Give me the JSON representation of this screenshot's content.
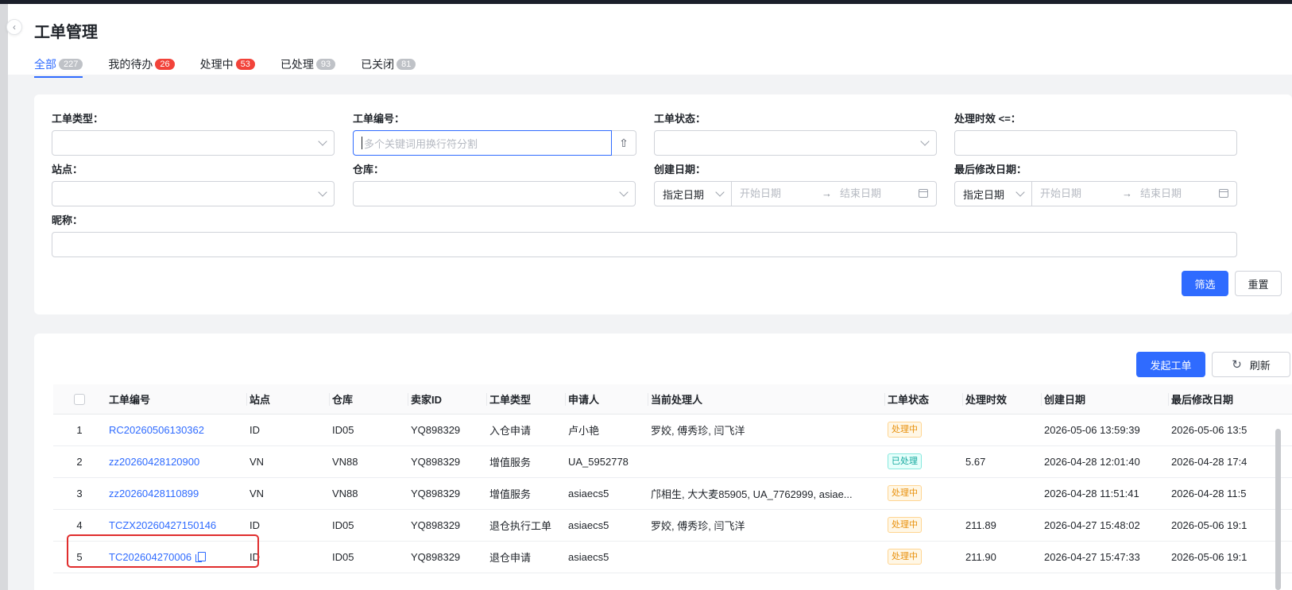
{
  "page": {
    "title": "工单管理",
    "tabs": [
      {
        "label": "全部",
        "count": "227",
        "active": true
      },
      {
        "label": "我的待办",
        "count": "26"
      },
      {
        "label": "处理中",
        "count": "53"
      },
      {
        "label": "已处理",
        "count": "93"
      },
      {
        "label": "已关闭",
        "count": "81"
      }
    ]
  },
  "filters": {
    "ticket_type": {
      "label": "工单类型："
    },
    "ticket_no": {
      "label": "工单编号：",
      "placeholder": "多个关键词用换行符分割"
    },
    "ticket_status": {
      "label": "工单状态："
    },
    "sla": {
      "label": "处理时效 <=："
    },
    "site": {
      "label": "站点："
    },
    "warehouse": {
      "label": "仓库："
    },
    "created": {
      "label": "创建日期：",
      "mode": "指定日期",
      "start": "开始日期",
      "end": "结束日期",
      "arrow": "→"
    },
    "modified": {
      "label": "最后修改日期：",
      "mode": "指定日期",
      "start": "开始日期",
      "end": "结束日期",
      "arrow": "→"
    },
    "nickname": {
      "label": "昵称："
    },
    "filter_btn": "筛选",
    "reset_btn": "重置"
  },
  "toolbar": {
    "create_btn": "发起工单",
    "refresh_btn": "刷新"
  },
  "table": {
    "columns": [
      "工单编号",
      "站点",
      "仓库",
      "卖家ID",
      "工单类型",
      "申请人",
      "当前处理人",
      "工单状态",
      "处理时效",
      "创建日期",
      "最后修改日期"
    ],
    "rows": [
      {
        "idx": "1",
        "no": "RC20260506130362",
        "site": "ID",
        "wh": "ID05",
        "seller": "YQ898329",
        "type": "入仓申请",
        "applicant": "卢小艳",
        "handler": "罗姣, 傅秀珍, 闫飞洋",
        "status": "处理中",
        "status_kind": "processing",
        "sla": "",
        "created": "2026-05-06 13:59:39",
        "modified": "2026-05-06 13:5"
      },
      {
        "idx": "2",
        "no": "zz20260428120900",
        "site": "VN",
        "wh": "VN88",
        "seller": "YQ898329",
        "type": "增值服务",
        "applicant": "UA_5952778",
        "handler": "",
        "status": "已处理",
        "status_kind": "done",
        "sla": "5.67",
        "created": "2026-04-28 12:01:40",
        "modified": "2026-04-28 17:4"
      },
      {
        "idx": "3",
        "no": "zz20260428110899",
        "site": "VN",
        "wh": "VN88",
        "seller": "YQ898329",
        "type": "增值服务",
        "applicant": "asiaecs5",
        "handler": "邝相生, 大大麦85905, UA_7762999, asiae...",
        "status": "处理中",
        "status_kind": "processing",
        "sla": "",
        "created": "2026-04-28 11:51:41",
        "modified": "2026-04-28 11:5"
      },
      {
        "idx": "4",
        "no": "TCZX20260427150146",
        "site": "ID",
        "wh": "ID05",
        "seller": "YQ898329",
        "type": "退仓执行工单",
        "applicant": "asiaecs5",
        "handler": "罗姣, 傅秀珍, 闫飞洋",
        "status": "处理中",
        "status_kind": "processing",
        "sla": "211.89",
        "created": "2026-04-27 15:48:02",
        "modified": "2026-05-06 19:1"
      },
      {
        "idx": "5",
        "no": "TC202604270006",
        "site": "ID",
        "wh": "ID05",
        "seller": "YQ898329",
        "type": "退仓申请",
        "applicant": "asiaecs5",
        "handler": "",
        "status": "处理中",
        "status_kind": "processing",
        "sla": "211.90",
        "created": "2026-04-27 15:47:33",
        "modified": "2026-05-06 19:1"
      }
    ]
  },
  "colors": {
    "accent": "#2f6bff",
    "badge_red": "#f2433a",
    "highlight": "#e02d2d"
  }
}
